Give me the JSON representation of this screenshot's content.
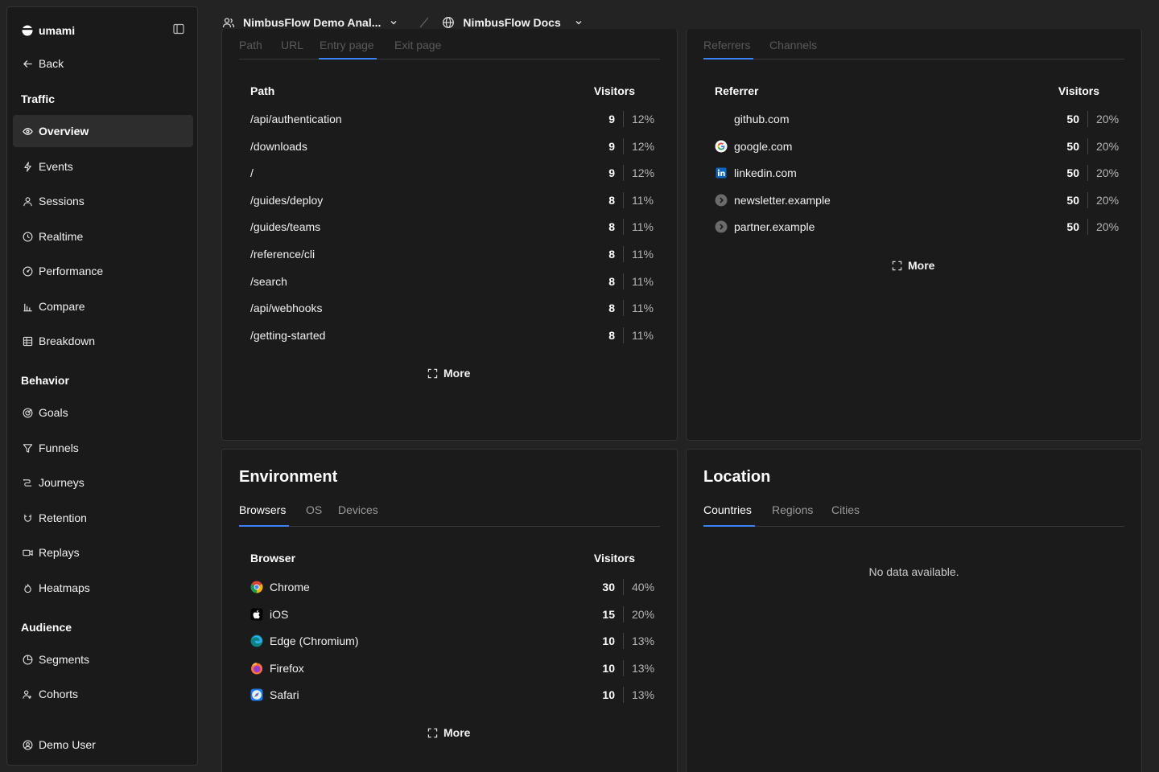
{
  "sidebar": {
    "brand": "umami",
    "back_label": "Back",
    "sections": {
      "traffic": "Traffic",
      "behavior": "Behavior",
      "audience": "Audience"
    },
    "items": {
      "overview": "Overview",
      "events": "Events",
      "sessions": "Sessions",
      "realtime": "Realtime",
      "performance": "Performance",
      "compare": "Compare",
      "breakdown": "Breakdown",
      "goals": "Goals",
      "funnels": "Funnels",
      "journeys": "Journeys",
      "retention": "Retention",
      "replays": "Replays",
      "heatmaps": "Heatmaps",
      "segments": "Segments",
      "cohorts": "Cohorts"
    },
    "user": "Demo User"
  },
  "topbar": {
    "team": "NimbusFlow Demo Anal...",
    "website": "NimbusFlow Docs"
  },
  "pages_panel": {
    "tabs": [
      "Path",
      "URL",
      "Entry page",
      "Exit page"
    ],
    "active_tab": "Entry page",
    "col_label": "Path",
    "col_value": "Visitors",
    "rows": [
      {
        "label": "/api/authentication",
        "count": "9",
        "pct": "12%"
      },
      {
        "label": "/downloads",
        "count": "9",
        "pct": "12%"
      },
      {
        "label": "/",
        "count": "9",
        "pct": "12%"
      },
      {
        "label": "/guides/deploy",
        "count": "8",
        "pct": "11%"
      },
      {
        "label": "/guides/teams",
        "count": "8",
        "pct": "11%"
      },
      {
        "label": "/reference/cli",
        "count": "8",
        "pct": "11%"
      },
      {
        "label": "/search",
        "count": "8",
        "pct": "11%"
      },
      {
        "label": "/api/webhooks",
        "count": "8",
        "pct": "11%"
      },
      {
        "label": "/getting-started",
        "count": "8",
        "pct": "11%"
      }
    ],
    "more_label": "More"
  },
  "referrers_panel": {
    "tabs": [
      "Referrers",
      "Channels"
    ],
    "active_tab": "Referrers",
    "col_label": "Referrer",
    "col_value": "Visitors",
    "rows": [
      {
        "label": "github.com",
        "count": "50",
        "pct": "20%",
        "icon": "none"
      },
      {
        "label": "google.com",
        "count": "50",
        "pct": "20%",
        "icon": "google-icon"
      },
      {
        "label": "linkedin.com",
        "count": "50",
        "pct": "20%",
        "icon": "linkedin-icon"
      },
      {
        "label": "newsletter.example",
        "count": "50",
        "pct": "20%",
        "icon": "link-icon"
      },
      {
        "label": "partner.example",
        "count": "50",
        "pct": "20%",
        "icon": "link-icon"
      }
    ],
    "more_label": "More"
  },
  "environment_panel": {
    "title": "Environment",
    "tabs": [
      "Browsers",
      "OS",
      "Devices"
    ],
    "active_tab": "Browsers",
    "col_label": "Browser",
    "col_value": "Visitors",
    "rows": [
      {
        "label": "Chrome",
        "count": "30",
        "pct": "40%",
        "icon": "chrome-icon"
      },
      {
        "label": "iOS",
        "count": "15",
        "pct": "20%",
        "icon": "apple-icon"
      },
      {
        "label": "Edge (Chromium)",
        "count": "10",
        "pct": "13%",
        "icon": "edge-icon"
      },
      {
        "label": "Firefox",
        "count": "10",
        "pct": "13%",
        "icon": "firefox-icon"
      },
      {
        "label": "Safari",
        "count": "10",
        "pct": "13%",
        "icon": "safari-icon"
      }
    ],
    "more_label": "More"
  },
  "location_panel": {
    "title": "Location",
    "tabs": [
      "Countries",
      "Regions",
      "Cities"
    ],
    "active_tab": "Countries",
    "empty_text": "No data available."
  },
  "colors": {
    "accent": "#3b82f6",
    "background": "#232323",
    "panel": "#1b1b1b"
  }
}
